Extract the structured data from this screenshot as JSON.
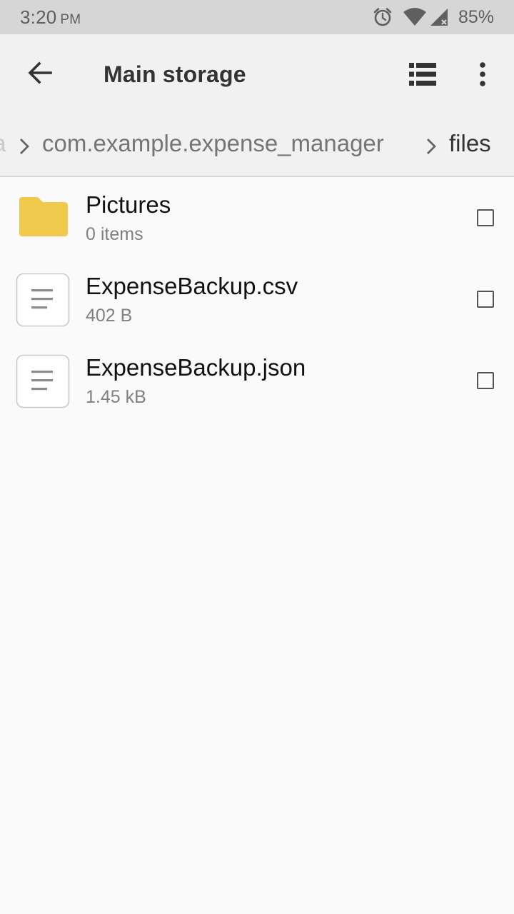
{
  "status_bar": {
    "time": "3:20",
    "ampm": "PM",
    "battery": "85%",
    "icons": [
      "alarm-icon",
      "wifi-icon",
      "cell-signal-icon"
    ]
  },
  "app_bar": {
    "title": "Main storage",
    "back_icon": "arrow-back-icon",
    "view_icon": "list-view-icon",
    "menu_icon": "more-vert-icon"
  },
  "breadcrumb": {
    "faded": "a",
    "items": [
      "com.example.expense_manager",
      "files"
    ]
  },
  "files": [
    {
      "name": "Pictures",
      "meta": "0 items",
      "type": "folder",
      "checked": false
    },
    {
      "name": "ExpenseBackup.csv",
      "meta": "402 B",
      "type": "file",
      "checked": false
    },
    {
      "name": "ExpenseBackup.json",
      "meta": "1.45 kB",
      "type": "file",
      "checked": false
    }
  ],
  "colors": {
    "folder": "#f0c84b",
    "status_bar": "#d6d6d6",
    "app_bar": "#f1f1f1",
    "background": "#fafafa"
  }
}
